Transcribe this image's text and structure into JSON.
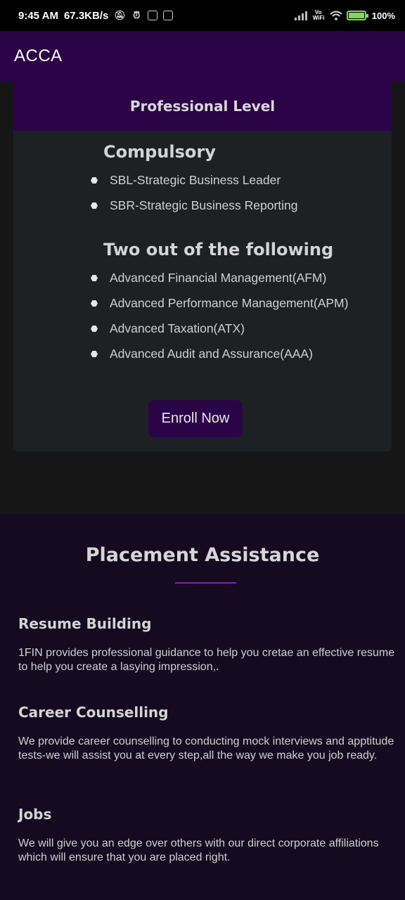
{
  "status_bar": {
    "time": "9:45 AM",
    "speed": "67.3KB/s",
    "vowifi": "Vo WiFi",
    "battery": "100%",
    "battery_level": 1.0
  },
  "app_bar": {
    "title": "ACCA"
  },
  "card": {
    "title": "Professional Level",
    "compulsory_heading": "Compulsory",
    "compulsory_items": [
      "SBL-Strategic Business Leader",
      "SBR-Strategic Business Reporting"
    ],
    "optional_heading": "Two out of the following",
    "optional_items": [
      "Advanced Financial Management(AFM)",
      "Advanced Performance Management(APM)",
      "Advanced Taxation(ATX)",
      "Advanced Audit and Assurance(AAA)"
    ],
    "enroll_label": "Enroll Now"
  },
  "placement": {
    "title": "Placement Assistance",
    "sections": [
      {
        "heading": "Resume Building",
        "text": "1FIN provides professional guidance to help you cretae an effective resume to help you create a lasying impression,."
      },
      {
        "heading": "Career Counselling",
        "text": "We provide career counselling to conducting mock interviews and apptitude tests-we will assist you at every step,all the way we make you job ready."
      },
      {
        "heading": "Jobs",
        "text": "We will give you an edge over others with our direct corporate affiliations which will ensure that you are placed right."
      }
    ]
  },
  "colors": {
    "primary": "#2b0447",
    "card_bg": "#1d2124",
    "placement_bg": "#150a20",
    "accent_line": "#7a2aa0"
  }
}
